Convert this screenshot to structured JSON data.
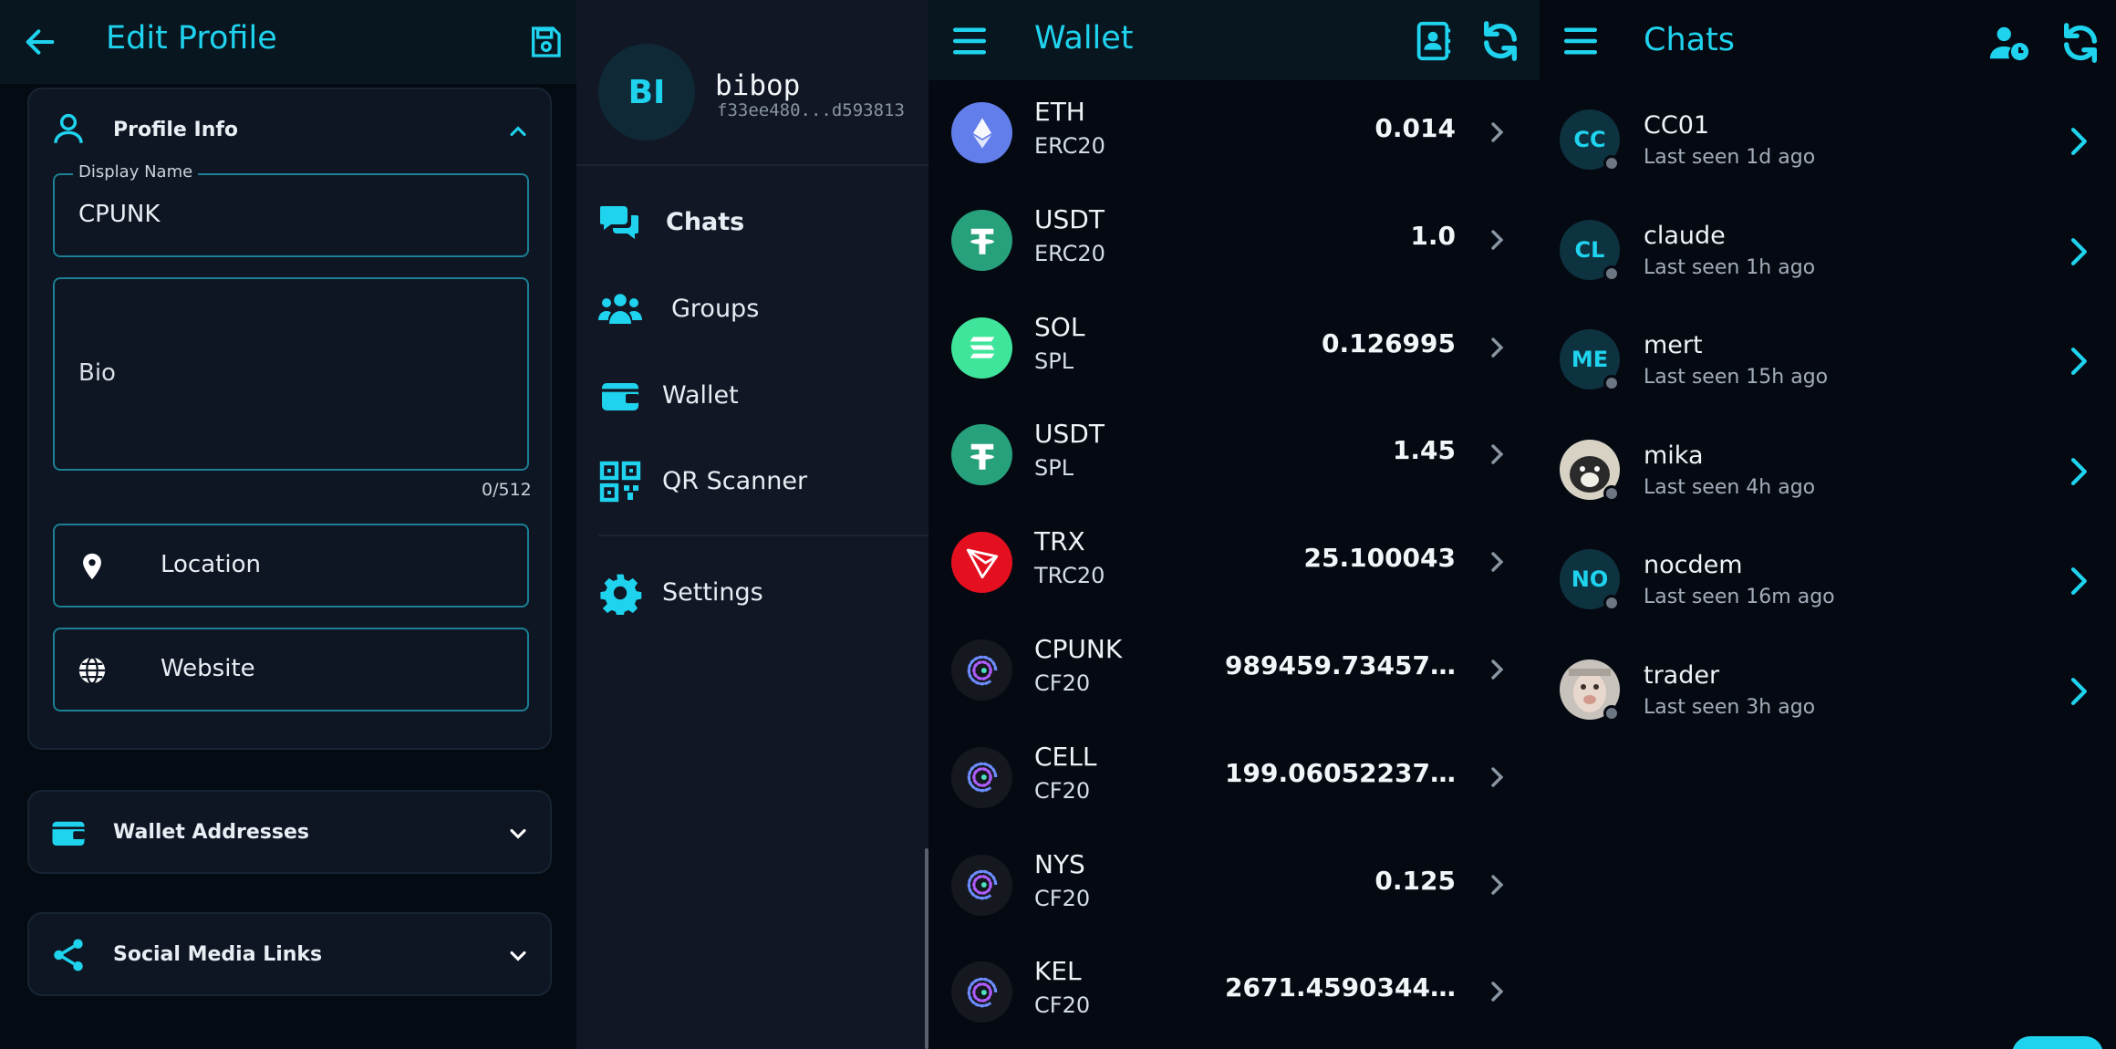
{
  "profile": {
    "title": "Edit Profile",
    "section_info": "Profile Info",
    "display_name_label": "Display Name",
    "display_name_value": "CPUNK",
    "bio_placeholder": "Bio",
    "bio_counter": "0/512",
    "location_placeholder": "Location",
    "website_placeholder": "Website",
    "section_wallets": "Wallet Addresses",
    "section_social": "Social Media Links"
  },
  "drawer": {
    "avatar_initials": "BI",
    "username": "bibop",
    "fingerprint": "f33ee480...d593813",
    "items": [
      {
        "label": "Chats",
        "icon": "chats-icon"
      },
      {
        "label": "Groups",
        "icon": "groups-icon"
      },
      {
        "label": "Wallet",
        "icon": "wallet-icon"
      },
      {
        "label": "QR Scanner",
        "icon": "qr-scanner-icon"
      },
      {
        "label": "Settings",
        "icon": "gear-icon"
      }
    ]
  },
  "wallet": {
    "title": "Wallet",
    "tokens": [
      {
        "symbol": "ETH",
        "network": "ERC20",
        "amount": "0.014",
        "icon": "eth-icon",
        "color": "#627eea"
      },
      {
        "symbol": "USDT",
        "network": "ERC20",
        "amount": "1.0",
        "icon": "tether-icon",
        "color": "#26a17b"
      },
      {
        "symbol": "SOL",
        "network": "SPL",
        "amount": "0.126995",
        "icon": "solana-icon",
        "color": "#3fe59a"
      },
      {
        "symbol": "USDT",
        "network": "SPL",
        "amount": "1.45",
        "icon": "tether-icon",
        "color": "#26a17b"
      },
      {
        "symbol": "TRX",
        "network": "TRC20",
        "amount": "25.100043",
        "icon": "tron-icon",
        "color": "#e5101f"
      },
      {
        "symbol": "CPUNK",
        "network": "CF20",
        "amount": "989459.73457…",
        "icon": "cellframe-icon",
        "color": "#15181f"
      },
      {
        "symbol": "CELL",
        "network": "CF20",
        "amount": "199.06052237…",
        "icon": "cellframe-icon",
        "color": "#15181f"
      },
      {
        "symbol": "NYS",
        "network": "CF20",
        "amount": "0.125",
        "icon": "cellframe-icon",
        "color": "#15181f"
      },
      {
        "symbol": "KEL",
        "network": "CF20",
        "amount": "2671.4590344…",
        "icon": "cellframe-icon",
        "color": "#15181f"
      }
    ]
  },
  "chats": {
    "title": "Chats",
    "contacts": [
      {
        "name": "CC01",
        "initials": "CC",
        "last_seen": "Last seen 1d ago"
      },
      {
        "name": "claude",
        "initials": "CL",
        "last_seen": "Last seen 1h ago"
      },
      {
        "name": "mert",
        "initials": "ME",
        "last_seen": "Last seen 15h ago"
      },
      {
        "name": "mika",
        "initials": "",
        "last_seen": "Last seen 4h ago"
      },
      {
        "name": "nocdem",
        "initials": "NO",
        "last_seen": "Last seen 16m ago"
      },
      {
        "name": "trader",
        "initials": "",
        "last_seen": "Last seen 3h ago"
      }
    ]
  },
  "colors": {
    "accent": "#1fd3ee",
    "appbar": "#081620",
    "card": "#0e1623"
  }
}
